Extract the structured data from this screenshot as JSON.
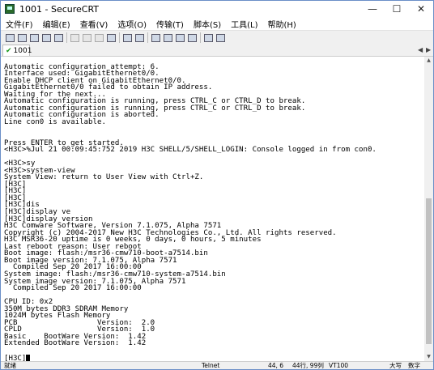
{
  "window": {
    "title": "1001 - SecureCRT"
  },
  "menu": [
    "文件(F)",
    "编辑(E)",
    "查看(V)",
    "选项(O)",
    "传输(T)",
    "脚本(S)",
    "工具(L)",
    "帮助(H)"
  ],
  "toolbar_icons": [
    "connect-icon",
    "quick-connect-icon",
    "connect-tab-icon",
    "reconnect-icon",
    "disconnect-icon",
    "copy-icon",
    "paste-icon",
    "copy-paste-icon",
    "find-icon",
    "print-icon",
    "print-setup-icon",
    "session-options-icon",
    "global-options-icon",
    "sftp-icon",
    "keymap-icon",
    "help-icon",
    "about-icon"
  ],
  "tab": {
    "label": "1001"
  },
  "terminal": {
    "lines": [
      "",
      "Automatic configuration attempt: 6.",
      "Interface used: GigabitEthernet0/0.",
      "Enable DHCP client on GigabitEthernet0/0.",
      "GigabitEthernet0/0 failed to obtain IP address.",
      "Waiting for the next...",
      "Automatic configuration is running, press CTRL_C or CTRL_D to break.",
      "Automatic configuration is running, press CTRL_C or CTRL_D to break.",
      "Automatic configuration is aborted.",
      "Line con0 is available.",
      "",
      "",
      "Press ENTER to get started.",
      "<H3C>%Jul 21 00:09:45:752 2019 H3C SHELL/5/SHELL_LOGIN: Console logged in from con0.",
      "",
      "<H3C>sy",
      "<H3C>system-view",
      "System View: return to User View with Ctrl+Z.",
      "[H3C]",
      "[H3C]",
      "[H3C]",
      "[H3C]dis",
      "[H3C]display ve",
      "[H3C]display version",
      "H3C Comware Software, Version 7.1.075, Alpha 7571",
      "Copyright (c) 2004-2017 New H3C Technologies Co., Ltd. All rights reserved.",
      "H3C MSR36-20 uptime is 0 weeks, 0 days, 0 hours, 5 minutes",
      "Last reboot reason: User reboot",
      "Boot image: flash:/msr36-cmw710-boot-a7514.bin",
      "Boot image version: 7.1.075, Alpha 7571",
      "  Compiled Sep 20 2017 16:00:00",
      "System image: flash:/msr36-cmw710-system-a7514.bin",
      "System image version: 7.1.075, Alpha 7571",
      "  Compiled Sep 20 2017 16:00:00",
      "",
      "CPU ID: 0x2",
      "350M bytes DDR3 SDRAM Memory",
      "1024M bytes Flash Memory",
      "PCB                  Version:  2.0",
      "CPLD                 Version:  1.0",
      "Basic    BootWare Version:  1.42",
      "Extended BootWare Version:  1.42",
      "",
      "[H3C]"
    ]
  },
  "status": {
    "left": "就绪",
    "protocol": "Telnet",
    "position": "44,  6",
    "size": "44行, 99列",
    "emulation": "VT100",
    "caps": "大写",
    "num": "数字"
  }
}
